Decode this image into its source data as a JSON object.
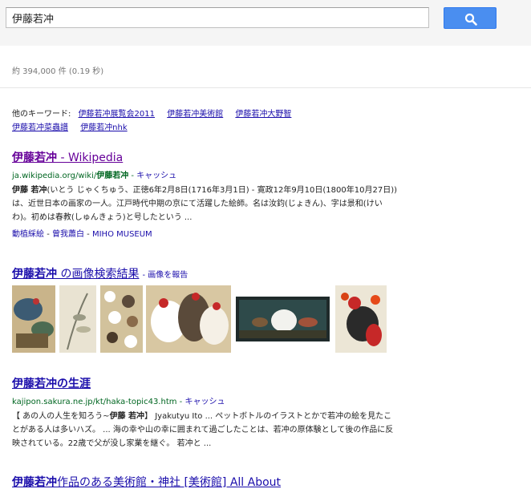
{
  "search": {
    "query": "伊藤若冲",
    "button_icon": "search-icon"
  },
  "stats": "約 394,000 件 (0.19 秒)",
  "keywords": {
    "label": "他のキーワード:",
    "items": [
      "伊藤若冲展覧会2011",
      "伊藤若冲美術館",
      "伊藤若冲大野智",
      "伊藤若冲菜蟲譜",
      "伊藤若冲nhk"
    ]
  },
  "results": [
    {
      "title_main": "伊藤若冲",
      "title_rest": " - Wikipedia",
      "url_pre": "ja.wikipedia.org/wiki/",
      "url_bold": "伊藤若冲",
      "cache": "キャッシュ",
      "snippet_bold": "伊藤 若冲",
      "snippet_1": "(いとう じゃくちゅう、正徳6年2月8日(1716年3月1日) - 寛政12年9月10日(1800年10月27日))は、近世日本の画家の一人。江戸時代中期の京にて活躍した絵師。名は汝鈞(じょきん)、字は景和(けいわ)。初めは春教(しゅんきょう)と号したという ...",
      "sitelinks": [
        "動植綵絵",
        "曾我蕭白",
        "MIHO MUSEUM"
      ]
    },
    {
      "title_main": "伊藤若冲の生涯",
      "url_pre": "kajipon.sakura.ne.jp/kt/haka-topic43.htm",
      "cache": "キャッシュ",
      "snippet_a": "【 あの人の人生を知ろう~",
      "snippet_bold": "伊藤 若冲",
      "snippet_b": "】 Jyakutyu Ito ... ペットボトルのイラストとかで若冲の絵を見たことがある人は多いハズ。 ... 海の幸や山の幸に囲まれて過ごしたことは、若冲の原体験として後の作品に反映されている。22歳で父が没し家業を継ぐ。 若冲と ..."
    },
    {
      "title_main": "伊藤若冲",
      "title_rest": "作品のある美術館・神社 [美術館] All About"
    }
  ],
  "images": {
    "title_main": "伊藤若冲",
    "title_rest": " の画像検索結果",
    "report": "- 画像を報告",
    "thumbs": [
      {
        "name": "thumb-painting-1"
      },
      {
        "name": "thumb-painting-2"
      },
      {
        "name": "thumb-painting-3"
      },
      {
        "name": "thumb-painting-4"
      },
      {
        "name": "thumb-painting-5"
      },
      {
        "name": "thumb-painting-6"
      }
    ]
  },
  "colors": {
    "link": "#1a0dab",
    "visited": "#660099",
    "url": "#006621",
    "button": "#4a8ef0"
  }
}
